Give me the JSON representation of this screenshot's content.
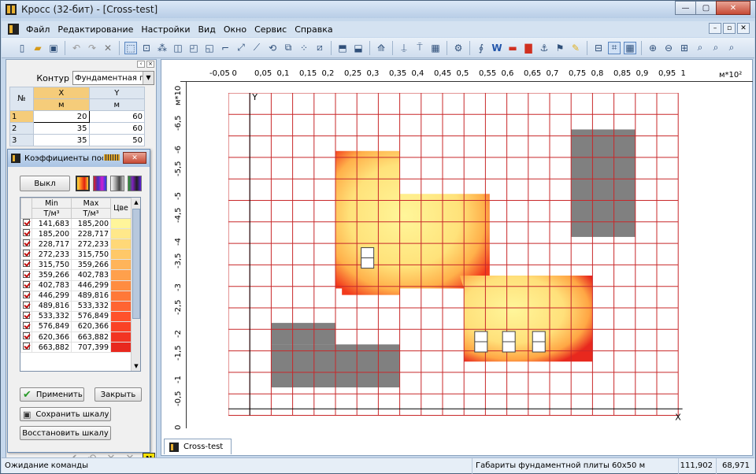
{
  "window": {
    "title": "Кросс (32-бит) - [Cross-test]",
    "caps": {
      "min": "—",
      "max": "▢",
      "close": "✕"
    }
  },
  "menu": [
    "Файл",
    "Редактирование",
    "Настройки",
    "Вид",
    "Окно",
    "Сервис",
    "Справка"
  ],
  "mdi_caps": [
    "–",
    "▫",
    "✕"
  ],
  "left_panel": {
    "contour_label": "Контур",
    "contour_value": "Фундаментная плит",
    "table": {
      "headers": [
        "№",
        "X",
        "Y"
      ],
      "units": [
        "м",
        "м"
      ],
      "rows": [
        {
          "n": "1",
          "x": "20",
          "y": "60"
        },
        {
          "n": "2",
          "x": "35",
          "y": "60"
        },
        {
          "n": "3",
          "x": "35",
          "y": "50"
        }
      ]
    }
  },
  "dialog": {
    "title": "Коэффициенты пос",
    "off_button": "Выкл",
    "columns": {
      "min": "Min",
      "max": "Max",
      "color": "Цве",
      "unit_min": "Т/м³",
      "unit_max": "Т/м³"
    },
    "rows": [
      {
        "min": "141,683",
        "max": "185,200",
        "color": "#fff59a"
      },
      {
        "min": "185,200",
        "max": "228,717",
        "color": "#ffe88a"
      },
      {
        "min": "228,717",
        "max": "272,233",
        "color": "#ffd878"
      },
      {
        "min": "272,233",
        "max": "315,750",
        "color": "#ffc868"
      },
      {
        "min": "315,750",
        "max": "359,266",
        "color": "#ffb45a"
      },
      {
        "min": "359,266",
        "max": "402,783",
        "color": "#ffa04c"
      },
      {
        "min": "402,783",
        "max": "446,299",
        "color": "#ff8c40"
      },
      {
        "min": "446,299",
        "max": "489,816",
        "color": "#ff7838"
      },
      {
        "min": "489,816",
        "max": "533,332",
        "color": "#ff6432"
      },
      {
        "min": "533,332",
        "max": "576,849",
        "color": "#ff522c"
      },
      {
        "min": "576,849",
        "max": "620,366",
        "color": "#fa4226"
      },
      {
        "min": "620,366",
        "max": "663,882",
        "color": "#f23422"
      },
      {
        "min": "663,882",
        "max": "707,399",
        "color": "#e8281e"
      }
    ],
    "apply": "Применить",
    "close": "Закрыть",
    "save_scale": "Сохранить шкалу",
    "restore_scale": "Восстановить шкалу"
  },
  "drawing": {
    "x_unit": "м*10²",
    "y_unit": "м*10",
    "x_ticks": [
      "-0,05",
      "0",
      "0,05",
      "0,1",
      "0,15",
      "0,2",
      "0,25",
      "0,3",
      "0,35",
      "0,4",
      "0,45",
      "0,5",
      "0,55",
      "0,6",
      "0,65",
      "0,7",
      "0,75",
      "0,8",
      "0,85",
      "0,9",
      "0,95",
      "1"
    ],
    "y_ticks": [
      "-6,5",
      "-6",
      "-5,5",
      "-5",
      "-4,5",
      "-4",
      "-3,5",
      "-3",
      "-2,5",
      "-2",
      "-1,5",
      "-1",
      "-0,5",
      "0"
    ],
    "axis_x_label": "X",
    "axis_y_label": "Y",
    "colors": {
      "grid": "#c8282a",
      "void": "#808080"
    }
  },
  "tabs": [
    "Cross-test"
  ],
  "status": {
    "message": "Ожидание команды",
    "info": "Габариты фундаментной плиты 60х50 м",
    "coord_x": "111,902",
    "coord_y": "68,971"
  }
}
